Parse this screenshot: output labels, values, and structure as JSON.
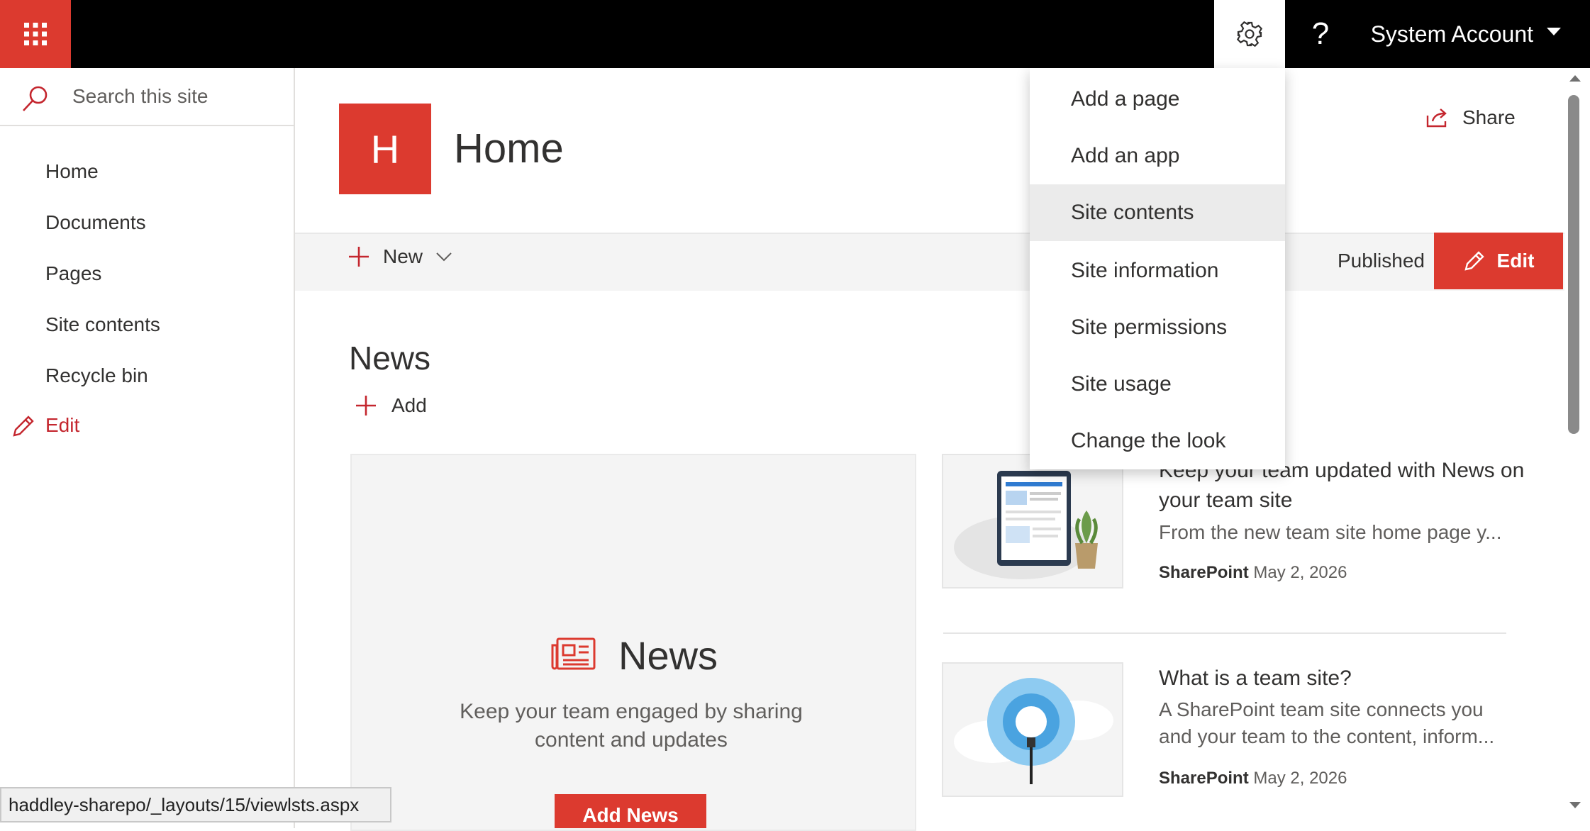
{
  "topbar": {
    "account_name": "System Account",
    "help_glyph": "?"
  },
  "search": {
    "placeholder": "Search this site"
  },
  "nav": {
    "items": [
      "Home",
      "Documents",
      "Pages",
      "Site contents",
      "Recycle bin"
    ],
    "edit_label": "Edit"
  },
  "site": {
    "logo_letter": "H",
    "title": "Home"
  },
  "share": {
    "label": "Share"
  },
  "commandbar": {
    "new_label": "New",
    "status": "Published",
    "edit_label": "Edit"
  },
  "news": {
    "heading": "News",
    "add_label": "Add",
    "card_title": "News",
    "card_description": "Keep your team engaged by sharing content and updates",
    "add_news_label": "Add News",
    "items": [
      {
        "title": "Keep your team updated with News on your team site",
        "description": "From the new team site home page y...",
        "author": "SharePoint",
        "date": "May 2, 2026"
      },
      {
        "title": "What is a team site?",
        "description": "A SharePoint team site connects you and your team to the content, inform...",
        "author": "SharePoint",
        "date": "May 2, 2026"
      }
    ]
  },
  "settings_menu": {
    "items": [
      "Add a page",
      "Add an app",
      "Site contents",
      "Site information",
      "Site permissions",
      "Site usage",
      "Change the look"
    ],
    "active_item": "Site contents"
  },
  "statusbar": {
    "url": "haddley-sharepo/_layouts/15/viewlsts.aspx"
  },
  "colors": {
    "accent": "#dc3a2f",
    "topbar": "#000000"
  }
}
